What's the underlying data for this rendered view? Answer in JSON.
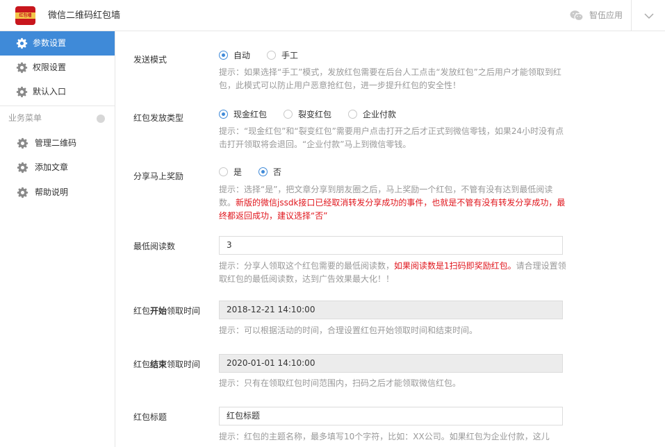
{
  "header": {
    "logo_text": "红包墙",
    "app_title": "微信二维码红包墙",
    "brand": "智伍应用"
  },
  "sidebar": {
    "items": [
      {
        "label": "参数设置"
      },
      {
        "label": "权限设置"
      },
      {
        "label": "默认入口"
      }
    ],
    "group_label": "业务菜单",
    "group_items": [
      {
        "label": "管理二维码"
      },
      {
        "label": "添加文章"
      },
      {
        "label": "帮助说明"
      }
    ]
  },
  "form": {
    "send_mode": {
      "label": "发送模式",
      "options": [
        "自动",
        "手工"
      ],
      "selected": "自动",
      "hint": "提示：如果选择“手工”模式，发放红包需要在后台人工点击“发放红包”之后用户才能领取到红包，此模式可以防止用户恶意抢红包，进一步提升红包的安全性！"
    },
    "packet_type": {
      "label": "红包发放类型",
      "options": [
        "现金红包",
        "裂变红包",
        "企业付款"
      ],
      "selected": "现金红包",
      "hint": "提示：“现金红包”和“裂变红包”需要用户点击打开之后才正式到微信零钱，如果24小时没有点击打开领取将会退回。“企业付款”马上到微信零钱。"
    },
    "share_reward": {
      "label": "分享马上奖励",
      "options": [
        "是",
        "否"
      ],
      "selected": "否",
      "hint_gray": "提示：选择“是”，把文章分享到朋友圈之后，马上奖励一个红包，不管有没有达到最低阅读数。",
      "hint_red": "新版的微信jssdk接口已经取消转发分享成功的事件，也就是不管有没有转发分享成功，最终都返回成功，建议选择“否”"
    },
    "min_reads": {
      "label": "最低阅读数",
      "value": "3",
      "hint_a": "提示：分享人领取这个红包需要的最低阅读数，",
      "hint_red": "如果阅读数是1扫码即奖励红包。",
      "hint_b": "请合理设置领取红包的最低阅读数，达到广告效果最大化！！"
    },
    "start_time": {
      "label_a": "红包",
      "label_bold": "开始",
      "label_b": "领取时间",
      "value": "2018-12-21 14:10:00",
      "hint": "提示：可以根据活动的时间，合理设置红包开始领取时间和结束时间。"
    },
    "end_time": {
      "label_a": "红包",
      "label_bold": "结束",
      "label_b": "领取时间",
      "value": "2020-01-01 14:10:00",
      "hint": "提示：只有在领取红包时间范围内，扫码之后才能领取微信红包。"
    },
    "title": {
      "label": "红包标题",
      "value": "红包标题",
      "hint": "提示：红包的主题名称，最多填写10个字符，比如：XX公司。如果红包为企业付款，这儿"
    }
  }
}
